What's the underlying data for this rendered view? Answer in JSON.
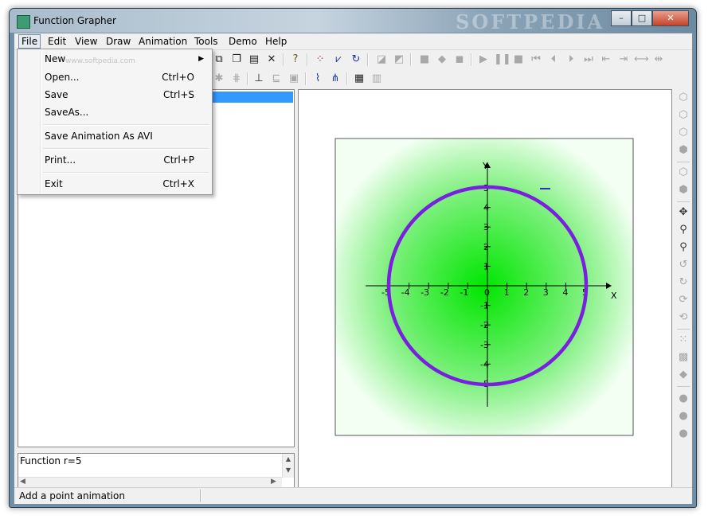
{
  "window": {
    "title": "Function Grapher",
    "watermark": "SOFTPEDIA",
    "controls": {
      "minimize": "–",
      "maximize": "□",
      "close": "✕"
    }
  },
  "menubar": {
    "items": [
      "File",
      "Edit",
      "View",
      "Draw",
      "Animation",
      "Tools",
      "Demo",
      "Help"
    ],
    "active": "File"
  },
  "file_menu": {
    "items": [
      {
        "label": "New",
        "shortcut": "",
        "submenu": true
      },
      {
        "label": "Open...",
        "shortcut": "Ctrl+O"
      },
      {
        "label": "Save",
        "shortcut": "Ctrl+S"
      },
      {
        "label": "SaveAs...",
        "shortcut": ""
      },
      {
        "label": "Save Animation As AVI",
        "shortcut": ""
      },
      {
        "label": "Print...",
        "shortcut": "Ctrl+P"
      },
      {
        "label": "Exit",
        "shortcut": "Ctrl+X"
      }
    ],
    "watermark": "www.softpedia.com"
  },
  "function_box": {
    "text": "Function r=5"
  },
  "statusbar": {
    "text": "Add a point animation"
  },
  "graph": {
    "x_axis_label": "X",
    "y_axis_label": "Y",
    "x_ticks": [
      "-5",
      "-4",
      "-3",
      "-2",
      "-1",
      "0",
      "1",
      "2",
      "3",
      "4",
      "5"
    ],
    "y_ticks": [
      "5",
      "4",
      "3",
      "2",
      "1",
      "-1",
      "-2",
      "-3",
      "-4",
      "-5"
    ],
    "curve_color": "#7a1ee0",
    "fill_color": "#00e600",
    "radius": 5
  }
}
